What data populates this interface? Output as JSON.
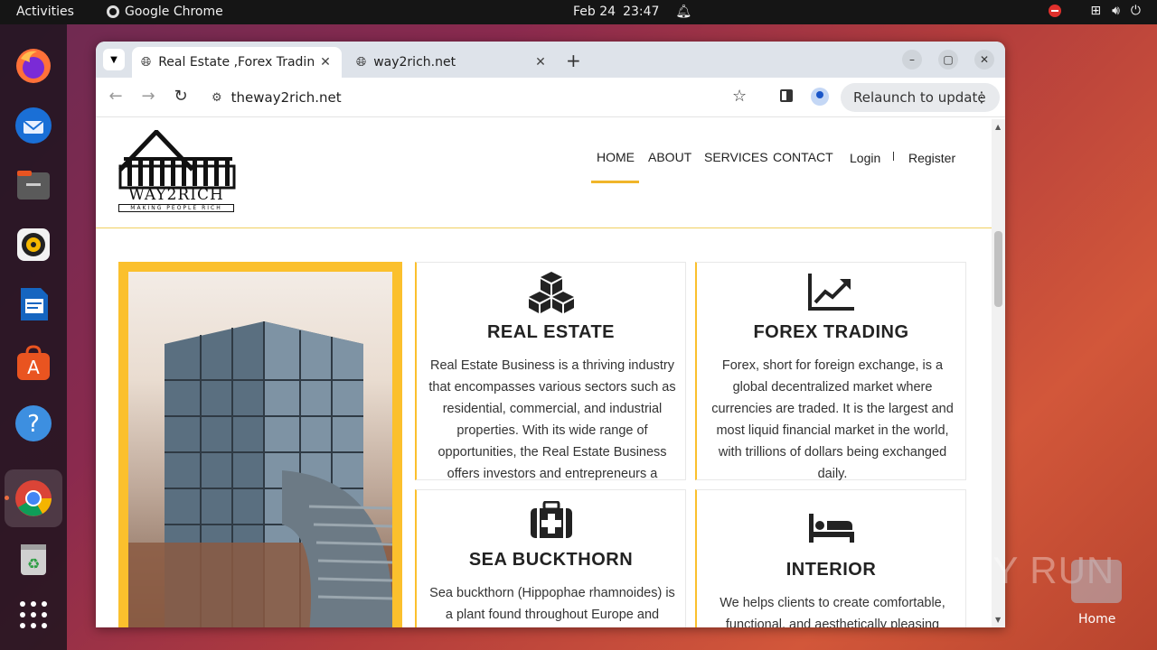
{
  "topbar": {
    "activities": "Activities",
    "app_name": "Google Chrome",
    "date": "Feb 24",
    "time": "23:47"
  },
  "dock": {
    "items": [
      "firefox-icon",
      "thunderbird-icon",
      "files-icon",
      "rhythmbox-icon",
      "writer-icon",
      "app-center-icon",
      "help-icon",
      "chrome-icon",
      "trash-icon",
      "show-apps-icon"
    ]
  },
  "browser": {
    "tabs": [
      {
        "title": "Real Estate ,Forex Tradin",
        "active": true
      },
      {
        "title": "way2rich.net",
        "active": false
      }
    ],
    "url": "theway2rich.net",
    "relaunch_label": "Relaunch to update"
  },
  "site": {
    "logo_text": "WAY2RICH",
    "logo_tagline": "MAKING PEOPLE RICH",
    "nav": [
      "HOME",
      "ABOUT",
      "SERVICES",
      "CONTACT"
    ],
    "login": "Login",
    "register": "Register",
    "cards": [
      {
        "icon": "cubes-icon",
        "title": "REAL ESTATE",
        "lines": [
          "Real Estate Business is a thriving industry",
          "that encompasses various sectors such as",
          "residential, commercial, and industrial",
          "properties. With its wide range of",
          "opportunities, the Real Estate Business",
          "offers investors and entrepreneurs a"
        ]
      },
      {
        "icon": "chart-line-icon",
        "title": "FOREX TRADING",
        "lines": [
          "Forex, short for foreign exchange, is a",
          "global decentralized market where",
          "currencies are traded. It is the largest and",
          "most liquid financial market in the world,",
          "with trillions of dollars being exchanged",
          "daily."
        ]
      },
      {
        "icon": "medkit-icon",
        "title": "SEA BUCKTHORN",
        "lines": [
          "Sea buckthorn (Hippophae rhamnoides) is",
          "a plant found throughout Europe and"
        ]
      },
      {
        "icon": "bed-icon",
        "title": "INTERIOR",
        "lines": [
          "We helps clients to create comfortable,",
          "functional, and aesthetically pleasing"
        ]
      }
    ]
  },
  "desktop": {
    "watermark": "ANY RUN",
    "home_label": "Home"
  }
}
